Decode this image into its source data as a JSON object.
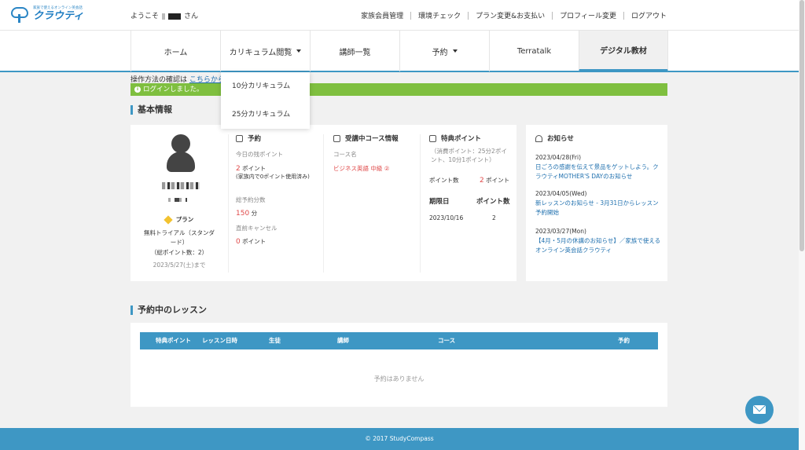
{
  "logo": {
    "tagline": "家族で使えるオンライン英会話",
    "name": "クラウティ"
  },
  "header": {
    "welcome_prefix": "ようこそ",
    "welcome_suffix": "さん",
    "links": [
      "家族会員管理",
      "環境チェック",
      "プラン変更&お支払い",
      "プロフィール変更",
      "ログアウト"
    ]
  },
  "nav": {
    "items": [
      {
        "label": "ホーム"
      },
      {
        "label": "カリキュラム閲覧",
        "dropdown": true
      },
      {
        "label": "講師一覧"
      },
      {
        "label": "予約",
        "dropdown": true
      },
      {
        "label": "Terratalk"
      },
      {
        "label": "デジタル教材",
        "active": true
      }
    ],
    "curriculum_menu": [
      "10分カリキュラム",
      "25分カリキュラム"
    ]
  },
  "help": {
    "text": "操作方法の確認は",
    "link": "こちらから"
  },
  "flash": {
    "message": "ログインしました。"
  },
  "basic_info": {
    "title": "基本情報",
    "profile": {
      "plan_label": "プラン",
      "plan_name": "無料トライアル（スタンダード）",
      "total_points": "（総ポイント数：2）",
      "expiry": "2023/5/27(土)まで"
    },
    "reservation": {
      "title": "予約",
      "remaining_label": "今日の残ポイント",
      "remaining_value": "2",
      "remaining_unit": "ポイント",
      "remaining_note": "(家族内で0ポイント使用済み)",
      "total_minutes_label": "総予約分数",
      "total_minutes_value": "150",
      "total_minutes_unit": "分",
      "cancel_label": "直前キャンセル",
      "cancel_value": "0",
      "cancel_unit": "ポイント"
    },
    "course": {
      "title": "受講中コース情報",
      "course_name_label": "コース名",
      "course_name": "ビジネス英語 中級 ②"
    },
    "special_points": {
      "title": "特典ポイント",
      "note": "（消費ポイント：25分2ポイント、10分1ポイント）",
      "points_label": "ポイント数",
      "points_value": "2",
      "points_unit": "ポイント",
      "table_headers": [
        "期限日",
        "ポイント数"
      ],
      "rows": [
        {
          "date": "2023/10/16",
          "points": "2"
        }
      ]
    },
    "news": {
      "title": "お知らせ",
      "items": [
        {
          "date": "2023/04/28(Fri)",
          "text": "日ごろの感謝を伝えて景品をゲットしよう。クラウティMOTHER'S DAYのお知らせ"
        },
        {
          "date": "2023/04/05(Wed)",
          "text": "新レッスンのお知らせ - 3月31日からレッスン予約開始"
        },
        {
          "date": "2023/03/27(Mon)",
          "text": "【4月・5月の休講のお知らせ】／家族で使えるオンライン英会話クラウティ"
        }
      ]
    }
  },
  "lessons": {
    "title": "予約中のレッスン",
    "columns": [
      "特典ポイント",
      "レッスン日時",
      "生徒",
      "講師",
      "コース",
      "予約"
    ],
    "empty_text": "予約はありません"
  },
  "footer": {
    "copyright": "© 2017 StudyCompass"
  },
  "colors": {
    "accent": "#3e97c4",
    "success": "#7fbf3f",
    "alert": "#e04b4b",
    "link": "#1e6fae"
  }
}
